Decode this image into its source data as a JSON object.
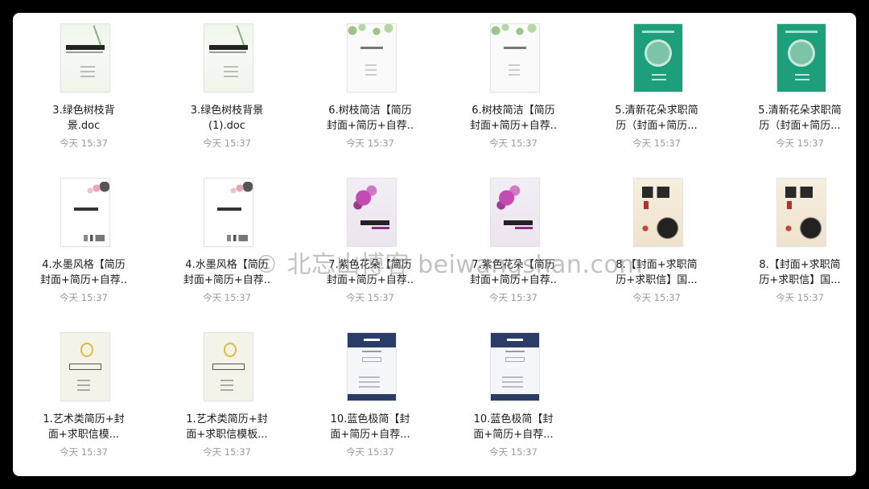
{
  "files": [
    {
      "line1": "3.绿色树枝背",
      "line2": "景.doc",
      "time": "今天 15:37",
      "thumb": "leaf"
    },
    {
      "line1": "3.绿色树枝背景",
      "line2": "(1).doc",
      "time": "今天 15:37",
      "thumb": "leaf"
    },
    {
      "line1": "6.树枝简洁【简历",
      "line2": "封面+简历+自荐..",
      "time": "今天 15:37",
      "thumb": "twig"
    },
    {
      "line1": "6.树枝简洁【简历",
      "line2": "封面+简历+自荐..",
      "time": "今天 15:37",
      "thumb": "twig"
    },
    {
      "line1": "5.清新花朵求职简",
      "line2": "历（封面+简历...",
      "time": "今天 15:37",
      "thumb": "green"
    },
    {
      "line1": "5.清新花朵求职简",
      "line2": "历（封面+简历...",
      "time": "今天 15:37",
      "thumb": "green"
    },
    {
      "line1": "4.水墨风格【简历",
      "line2": "封面+简历+自荐..",
      "time": "今天 15:37",
      "thumb": "ink"
    },
    {
      "line1": "4.水墨风格【简历",
      "line2": "封面+简历+自荐..",
      "time": "今天 15:37",
      "thumb": "ink"
    },
    {
      "line1": "7.紫色花朵【简历",
      "line2": "封面+简历+自荐..",
      "time": "今天 15:37",
      "thumb": "purple"
    },
    {
      "line1": "7.紫色花朵【简历",
      "line2": "封面+简历+自荐..",
      "time": "今天 15:37",
      "thumb": "purple"
    },
    {
      "line1": "8.【封面+求职简",
      "line2": "历+求职信】国...",
      "time": "今天 15:37",
      "thumb": "brush"
    },
    {
      "line1": "8.【封面+求职简",
      "line2": "历+求职信】国...",
      "time": "今天 15:37",
      "thumb": "brush"
    },
    {
      "line1": "1.艺术类简历+封",
      "line2": "面+求职信模...",
      "time": "今天 15:37",
      "thumb": "bulb"
    },
    {
      "line1": "1.艺术类简历+封",
      "line2": "面+求职信模板...",
      "time": "今天 15:37",
      "thumb": "bulb"
    },
    {
      "line1": "10.蓝色极简【封",
      "line2": "面+简历+自荐...",
      "time": "今天 15:37",
      "thumb": "blue"
    },
    {
      "line1": "10.蓝色极简【封",
      "line2": "面+简历+自荐...",
      "time": "今天 15:37",
      "thumb": "blue"
    }
  ],
  "watermark": "© 北忘山博客 beiwangshan.com"
}
